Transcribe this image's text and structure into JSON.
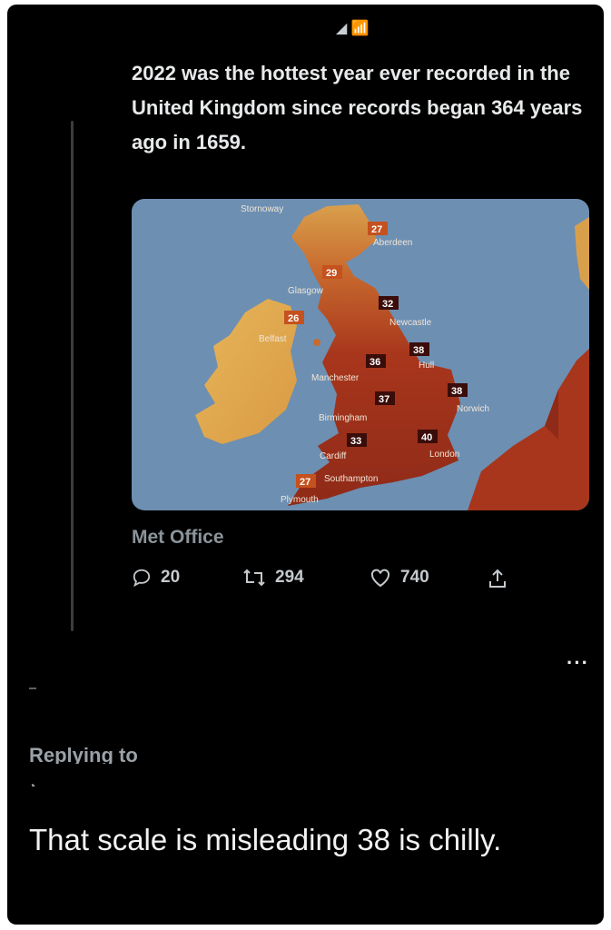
{
  "tweet": {
    "text": "2022 was the hottest year ever recorded in the United Kingdom since records began 364 years ago in 1659.",
    "source": "Met Office",
    "stats": {
      "replies": "20",
      "retweets": "294",
      "likes": "740"
    }
  },
  "map": {
    "places": [
      "Stornoway",
      "Aberdeen",
      "Glasgow",
      "Belfast",
      "Newcastle",
      "Manchester",
      "Hull",
      "Norwich",
      "Birmingham",
      "Cardiff",
      "London",
      "Southampton",
      "Plymouth"
    ],
    "temps": [
      "27",
      "29",
      "26",
      "32",
      "36",
      "38",
      "37",
      "38",
      "33",
      "40",
      "27"
    ],
    "colors": {
      "sea": "#6d8fb2",
      "ireland": "#e2ad52",
      "hot": "#b23a1f",
      "very_hot": "#8e2a18"
    }
  },
  "reply": {
    "replying_to": "Replying to",
    "text": "That scale is misleading 38 is chilly."
  },
  "icons": [
    "reply-icon",
    "retweet-icon",
    "like-icon",
    "share-icon",
    "more-icon"
  ]
}
